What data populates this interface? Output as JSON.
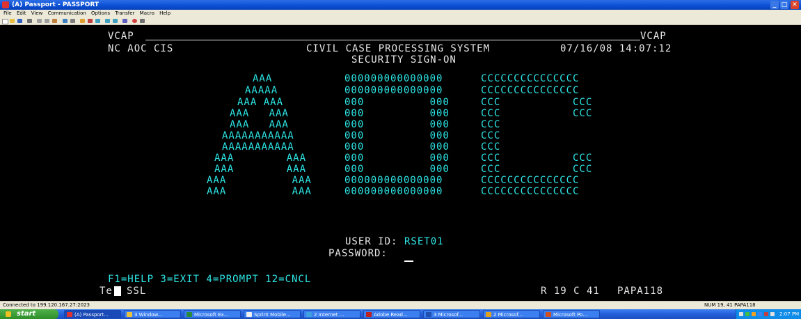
{
  "window": {
    "title": "(A) Passport - PASSPORT",
    "icon": "terminal-app-icon"
  },
  "window_buttons": {
    "minimize_icon": "_",
    "maximize_icon": "□",
    "close_icon": "✕"
  },
  "menu": [
    "File",
    "Edit",
    "View",
    "Communication",
    "Options",
    "Transfer",
    "Macro",
    "Help"
  ],
  "colors": {
    "screen_bg": "#000000",
    "host_text": "#e8e8e8",
    "field_text": "#2ee6e6",
    "titlebar": "#0a4fd4",
    "taskbar": "#245edb",
    "start": "#2e8f2a"
  },
  "terminal": {
    "vcap_left": "VCAP",
    "vcap_right": "VCAP",
    "agency": "NC AOC CIS",
    "system_title": "CIVIL CASE PROCESSING SYSTEM",
    "datetime": "07/16/08 14:07:12",
    "screen_title": "SECURITY SIGN-ON",
    "banner_a": [
      "AAA",
      "AAAAA",
      "AAA AAA",
      "AAA   AAA",
      "AAA   AAA",
      "AAAAAAAAAAA",
      "AAAAAAAAAAA",
      "AAA        AAA",
      "AAA        AAA",
      "AAA          AAA",
      "AAA          AAA"
    ],
    "banner_o": [
      "000000000000000",
      "000000000000000",
      "000          000",
      "000          000",
      "000          000",
      "000          000",
      "000          000",
      "000          000",
      "000          000",
      "000000000000000",
      "000000000000000"
    ],
    "banner_c": [
      "CCCCCCCCCCCCCCC",
      "CCCCCCCCCCCCCCC",
      "CCC           CCC",
      "CCC           CCC",
      "CCC",
      "CCC",
      "CCC",
      "CCC           CCC",
      "CCC           CCC",
      "CCCCCCCCCCCCCCC",
      "CCCCCCCCCCCCCCC"
    ],
    "user_id_label": "USER ID:",
    "user_id_value": "RSET01",
    "password_label": "PASSWORD:",
    "password_value": "",
    "function_keys": "F1=HELP 3=EXIT 4=PROMPT 12=CNCL",
    "oia_left": "Te",
    "oia_ssl": "SSL",
    "cursor_pos": "R 19 C 41",
    "session_id": "PAPA118"
  },
  "statusbar": {
    "connection": "Connected to 199.120.167.27:2023",
    "right": "NUM   19, 41  PAPA118"
  },
  "taskbar": {
    "start_label": "start",
    "tasks": [
      "(A) Passport...",
      "3 Window...",
      "Microsoft Ex...",
      "Sprint Mobile...",
      "2 Internet ...",
      "Adobe Read...",
      "3 Microsof...",
      "2 Microsof...",
      "Microsoft Po..."
    ],
    "clock": "2:07 PM"
  }
}
